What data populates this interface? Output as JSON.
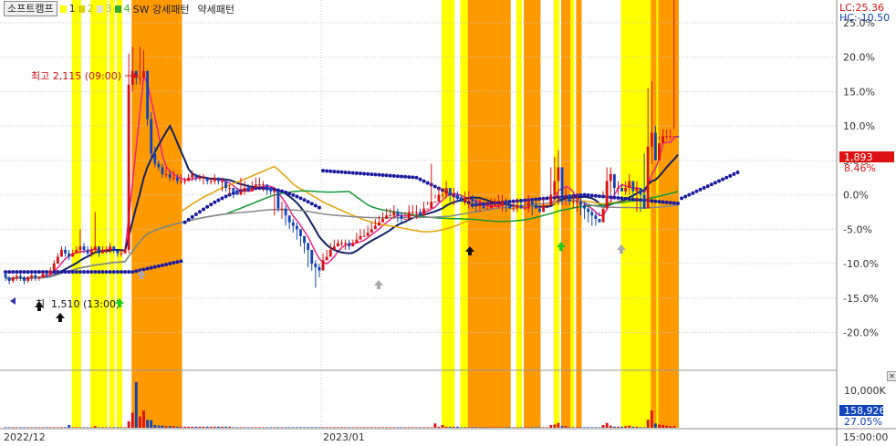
{
  "legend": {
    "title": "소프트캠프",
    "items": [
      {
        "label": "1",
        "color": "#ffff00"
      },
      {
        "label": "2",
        "color": "#e0d000"
      },
      {
        "label": "3",
        "color": "#dddddd"
      },
      {
        "label": "4",
        "color": "#33aa33"
      }
    ],
    "strong_label": "SW 강세패턴",
    "weak_label": "약세패턴"
  },
  "annotations": {
    "high": "최고 2,115 (09:00)",
    "low_prefix": "최",
    "low": "1,510 (13:00)"
  },
  "right_panel": {
    "lc": "LC:25.36",
    "hc": "HC:-10.50",
    "price_badge": "1,893",
    "pct_badge": "8.46%",
    "volume_badge": "158,926",
    "volume_pct": "27.05%",
    "volume_tick": "10,000K"
  },
  "x_axis": {
    "labels": [
      "2022/12",
      "2023/01"
    ],
    "time": "15:00:00"
  },
  "colors": {
    "yellow_band": "#ffff00",
    "orange_band": "#ff9900",
    "up": "#dd1111",
    "down": "#1144bb",
    "ma_pink": "#ee2288",
    "ma_navy": "#112266",
    "ma_gold": "#e8a000",
    "ma_green": "#119933",
    "ma_gray": "#888888",
    "dots": "#1a1aa0"
  },
  "chart_data": {
    "type": "candlestick",
    "ylabel_unit": "%",
    "ylim": [
      -25.36,
      27.5
    ],
    "y_ticks": [
      25,
      20,
      15,
      10,
      5,
      0,
      -5,
      -10,
      -15,
      -20
    ],
    "y_tick_labels": [
      "25.0%",
      "20.0%",
      "15.0%",
      "10.0%",
      "5.0%",
      "0.0%",
      "-5.0%",
      "-10.0%",
      "-15.0%",
      "-20.0%"
    ],
    "series": [
      {
        "name": "candles",
        "x": [
          1,
          2,
          3,
          4,
          5,
          6,
          7,
          8,
          9,
          10,
          11,
          12,
          13,
          14,
          15,
          16,
          17,
          18,
          19,
          20,
          21,
          22,
          23,
          24,
          25,
          26,
          27,
          28,
          29,
          30,
          31,
          32,
          33,
          34,
          35,
          36,
          37,
          38,
          39,
          40,
          41,
          42,
          43,
          44,
          45,
          46,
          47,
          48,
          49,
          50,
          51,
          52,
          53,
          54,
          55,
          56,
          57,
          58,
          59,
          60,
          61,
          62,
          63,
          64,
          65,
          66,
          67,
          68,
          69,
          70,
          71,
          72,
          73,
          74,
          75,
          76,
          77,
          78,
          79,
          80,
          81,
          82,
          83,
          84,
          85,
          86,
          87,
          88,
          89,
          90,
          91,
          92,
          93,
          94,
          95,
          96,
          97,
          98,
          99,
          100,
          101,
          102,
          103,
          104,
          105,
          106,
          107,
          108,
          109,
          110,
          111,
          112,
          113,
          114,
          115,
          116,
          117,
          118,
          119,
          120,
          121,
          122,
          123,
          124,
          125,
          126,
          127,
          128,
          129,
          130,
          131,
          132,
          133,
          134,
          135,
          136,
          137,
          138,
          139,
          140,
          141,
          142,
          143,
          144,
          145,
          146,
          147,
          148,
          149,
          150,
          151,
          152,
          153,
          154,
          155,
          156,
          157,
          158,
          159,
          160,
          161,
          162,
          163,
          164,
          165,
          166,
          167,
          168,
          169,
          170,
          171,
          172,
          173,
          174,
          175,
          176,
          177,
          178,
          179,
          180,
          181,
          182,
          183,
          184
        ],
        "open": [
          -11.5,
          -12,
          -12.5,
          -12,
          -11.8,
          -12,
          -12.5,
          -12,
          -11.7,
          -12,
          -12,
          -11.5,
          -11.6,
          -11,
          -10,
          -9,
          -8,
          -8.5,
          -9,
          -8.5,
          -8,
          -7.5,
          -8,
          -8.5,
          -8,
          -7.5,
          -8.5,
          -8,
          -8,
          -7.5,
          -8,
          -8.5,
          -8.5,
          -8,
          16,
          18,
          17,
          17,
          18,
          11,
          6,
          4.5,
          4,
          3,
          3,
          2.5,
          2.5,
          2,
          2,
          2,
          2.5,
          3,
          2.5,
          2.5,
          2.5,
          2,
          2,
          2.5,
          2,
          2,
          1,
          1,
          0.5,
          0,
          0.5,
          1,
          0.5,
          1,
          1.5,
          1.5,
          1.5,
          1,
          0.5,
          0.5,
          -2,
          -2,
          -3,
          -4,
          -4.5,
          -5,
          -6,
          -7,
          -8,
          -10,
          -10.5,
          -11,
          -9.5,
          -9,
          -8,
          -7.5,
          -7,
          -7,
          -7,
          -7.5,
          -7,
          -6.5,
          -6,
          -6,
          -5.5,
          -5,
          -4.5,
          -4,
          -3.5,
          -3,
          -3,
          -2.5,
          -3,
          -3.5,
          -3.5,
          -2.5,
          -2.5,
          -2.5,
          -3,
          -2,
          -2,
          -1,
          -1,
          0,
          0,
          1,
          0,
          0,
          -0.5,
          -1,
          -0.5,
          -0.5,
          -1,
          -1.5,
          -1.5,
          -2,
          -2,
          -1.5,
          -1.5,
          -1.5,
          -1,
          -1.5,
          -2,
          -2,
          -1.5,
          -2,
          -2,
          -1,
          -1.5,
          -2,
          -2.5,
          -1.5,
          -1.5,
          0,
          2,
          4,
          0,
          0,
          -1,
          -1,
          -1,
          -1.5,
          -2,
          -2.5,
          -3,
          -3.5,
          -4,
          -2,
          2,
          3,
          1,
          1,
          0.5,
          1,
          2,
          0.5,
          1,
          0,
          -2,
          7,
          9,
          5,
          7.5,
          8.5,
          8.5,
          8.5,
          8.5
        ],
        "close": [
          -12,
          -12.5,
          -12,
          -11.8,
          -12,
          -12.5,
          -12,
          -11.7,
          -12,
          -12,
          -11.5,
          -11.6,
          -11,
          -10,
          -9,
          -8,
          -8.5,
          -9,
          -8.5,
          -8,
          -7.5,
          -8,
          -8.5,
          -8,
          -7.5,
          -8.5,
          -8,
          -8,
          -7.5,
          -8,
          -8.5,
          -8.5,
          -8,
          16,
          18,
          17,
          17,
          18,
          11,
          6,
          4.5,
          4,
          3,
          3,
          2.5,
          2.5,
          2,
          2,
          2,
          2.5,
          3,
          2.5,
          2.5,
          2.5,
          2,
          2,
          2.5,
          2,
          2,
          1,
          1,
          0.5,
          0,
          0.5,
          1,
          0.5,
          1,
          1.5,
          1.5,
          1.5,
          1,
          0.5,
          0.5,
          -2,
          -2,
          -3,
          -4,
          -4.5,
          -5,
          -6,
          -7,
          -8,
          -10,
          -10.5,
          -11,
          -9.5,
          -9,
          -8,
          -7.5,
          -7,
          -7,
          -7,
          -7.5,
          -7,
          -6.5,
          -6,
          -6,
          -5.5,
          -5,
          -4.5,
          -4,
          -3.5,
          -3,
          -3,
          -2.5,
          -3,
          -3.5,
          -3.5,
          -2.5,
          -2.5,
          -2.5,
          -3,
          -2,
          -2,
          -1,
          -1,
          0,
          0,
          1,
          0,
          0,
          -0.5,
          -1,
          -0.5,
          -0.5,
          -1,
          -1.5,
          -1.5,
          -2,
          -2,
          -1.5,
          -1.5,
          -1.5,
          -1,
          -1.5,
          -2,
          -2,
          -1.5,
          -2,
          -2,
          -1,
          -1.5,
          -2,
          -2.5,
          -1.5,
          -1.5,
          0,
          2,
          4,
          0,
          0,
          -1,
          -1,
          -1,
          -1.5,
          -2,
          -2.5,
          -3,
          -3.5,
          -4,
          -2,
          2,
          3,
          1,
          1,
          0.5,
          1,
          2,
          0.5,
          1,
          0,
          -2,
          7,
          9,
          5,
          7.5,
          8.5,
          8.5,
          8.5,
          8.5,
          8.46
        ],
        "high": [
          -11.2,
          -11.8,
          -11.8,
          -11.5,
          -11.5,
          -11.8,
          -11.8,
          -11.5,
          -11.5,
          -11.8,
          -11.2,
          -11.2,
          -10.5,
          -9.5,
          -8.5,
          -7.5,
          -7.5,
          -8,
          -8,
          -7.5,
          -5,
          -7,
          -7.5,
          -7.5,
          -2.5,
          -7.5,
          -7.5,
          -7.5,
          -7,
          -7.5,
          -8,
          -8,
          -7.5,
          20.5,
          21.5,
          18,
          21.5,
          21,
          18,
          12,
          7,
          5,
          4.5,
          4,
          3.5,
          3.5,
          3,
          3,
          2.5,
          3,
          3.5,
          3,
          3,
          3,
          2.5,
          2.5,
          3,
          2.5,
          2.5,
          2,
          1.5,
          1,
          1,
          2.5,
          2,
          1.5,
          2,
          2.5,
          2.5,
          2,
          1.5,
          1,
          1,
          0,
          -1,
          -1.5,
          -3,
          -3.5,
          -4,
          -5,
          -6,
          -7,
          -8,
          -9.5,
          -10,
          -8.5,
          -8,
          -7,
          -6.5,
          -6.5,
          -6.5,
          -6.5,
          -6.5,
          -6.5,
          -5.5,
          -5,
          -5,
          -4.5,
          -4,
          -3.5,
          -3,
          -2.5,
          -2,
          -2,
          -1.5,
          -2,
          -2.5,
          -2.5,
          -1.5,
          -1.5,
          -1.5,
          -2,
          -1,
          -1,
          4.5,
          0,
          1,
          1,
          2,
          1,
          1,
          0.5,
          0,
          0.5,
          0.5,
          0,
          -0.5,
          -0.5,
          -1,
          -1,
          -0.5,
          -0.5,
          0,
          0,
          -0.5,
          -1,
          -1,
          -0.5,
          -1,
          -1,
          0,
          -0.5,
          -1,
          -1.5,
          -0.5,
          -0.5,
          4,
          5.5,
          6.5,
          1,
          1,
          0,
          0,
          0,
          -0.5,
          -1,
          -1.5,
          -2,
          -2.5,
          -3,
          0,
          4,
          4,
          2,
          2,
          1.5,
          2,
          3,
          1.5,
          2,
          1,
          0,
          15.5,
          16.5,
          10,
          8.5,
          9.5,
          9.5,
          9.5,
          9.5
        ],
        "low": [
          -12.5,
          -13,
          -12.8,
          -12.5,
          -12.5,
          -13,
          -12.8,
          -12.5,
          -12.5,
          -12.5,
          -12,
          -12,
          -11.5,
          -10.5,
          -9.5,
          -9,
          -9,
          -9.5,
          -9,
          -8.5,
          -8.5,
          -8.5,
          -9,
          -9,
          -8.5,
          -9,
          -8.5,
          -8.5,
          -8.5,
          -8.5,
          -9,
          -9,
          -8.5,
          -8.5,
          15,
          16,
          16,
          17,
          10,
          5,
          4,
          3.5,
          2.5,
          2.5,
          2,
          2,
          1.5,
          1.5,
          1.5,
          2,
          2,
          2,
          2,
          1.5,
          1.5,
          1.5,
          1.5,
          1.5,
          0.5,
          0.5,
          0,
          -0.5,
          0,
          0,
          0,
          0.5,
          1,
          1,
          1,
          0.5,
          0,
          0,
          -3,
          -2.5,
          -3.5,
          -4.5,
          -5,
          -5.5,
          -6.5,
          -7.5,
          -8.5,
          -10.5,
          -11,
          -13.5,
          -12,
          -10,
          -9,
          -8,
          -7.5,
          -7.5,
          -7.5,
          -8,
          -8,
          -7.5,
          -7,
          -6.5,
          -6,
          -5.5,
          -5,
          -4.5,
          -4,
          -3.5,
          -3.5,
          -3,
          -3.5,
          -4,
          -4,
          -3,
          -3,
          -3,
          -3.5,
          -2.5,
          -2.5,
          -1.5,
          -1.5,
          -0.5,
          -0.5,
          -0.5,
          -0.5,
          -1,
          -1.5,
          -1,
          -1,
          -1.5,
          -2,
          -2,
          -2.5,
          -2.5,
          -2,
          -2,
          -2,
          -1.5,
          -2,
          -2.5,
          -2.5,
          -2,
          -2.5,
          -2.5,
          -1.5,
          -2,
          -2.5,
          -3,
          -2,
          -2,
          -2,
          -0.5,
          -0.5,
          -0.5,
          -1.5,
          -1.5,
          -1.5,
          -1.5,
          -2,
          -2.5,
          -3,
          -3.5,
          -4,
          -4.5,
          -4.5,
          -2.5,
          0.5,
          0,
          0,
          0,
          0,
          1,
          0,
          0,
          -0.5,
          -2.5,
          -2.5,
          6,
          4.5,
          4.5,
          7,
          8,
          8,
          8,
          8
        ]
      },
      {
        "name": "volume",
        "values": [
          0.1,
          0.1,
          0.1,
          0.1,
          0.1,
          0.1,
          0.1,
          0.1,
          0.1,
          0.1,
          0.1,
          0.1,
          0.1,
          0.1,
          0.1,
          0.1,
          0.1,
          0.5,
          0.1,
          0.1,
          0.1,
          0.1,
          0.1,
          0.1,
          0.3,
          0.1,
          0.1,
          0.1,
          0.1,
          0.1,
          0.1,
          0.1,
          0.1,
          1.2,
          2.8,
          8.5,
          2.1,
          3.2,
          1.5,
          1.4,
          0.5,
          0.4,
          0.4,
          0.3,
          0.3,
          0.3,
          0.2,
          0.2,
          0.2,
          0.2,
          0.2,
          0.2,
          0.2,
          0.2,
          0.2,
          0.2,
          0.2,
          0.2,
          0.2,
          0.2,
          0.2,
          0.1,
          0.1,
          0.1,
          0.1,
          0.1,
          0.1,
          0.1,
          0.1,
          0.1,
          0.1,
          0.1,
          0.1,
          0.1,
          0.1,
          0.1,
          0.1,
          0.1,
          0.1,
          0.1,
          0.1,
          0.1,
          0.1,
          0.1,
          0.1,
          0.1,
          0.1,
          0.1,
          0.1,
          0.1,
          0.1,
          0.1,
          0.1,
          0.1,
          0.1,
          0.1,
          0.1,
          0.1,
          0.1,
          0.1,
          0.1,
          0.1,
          0.1,
          0.1,
          0.1,
          0.1,
          0.1,
          0.1,
          0.1,
          0.1,
          0.1,
          0.1,
          0.1,
          0.1,
          0.1,
          0.8,
          0.2,
          0.5,
          0.2,
          0.2,
          0.2,
          0.2,
          0.1,
          0.1,
          0.1,
          0.1,
          0.1,
          0.1,
          0.1,
          0.1,
          0.1,
          0.1,
          0.1,
          0.1,
          0.1,
          0.1,
          0.1,
          0.1,
          0.1,
          0.1,
          0.1,
          0.1,
          0.1,
          0.1,
          0.1,
          0.1,
          0.5,
          0.6,
          0.9,
          0.3,
          0.3,
          0.1,
          0.1,
          0.1,
          0.1,
          0.1,
          0.1,
          0.1,
          0.1,
          0.1,
          0.5,
          0.9,
          0.4,
          0.2,
          0.2,
          0.2,
          0.3,
          0.4,
          0.2,
          0.2,
          0.1,
          0.1,
          1.5,
          3.2,
          0.8,
          0.6,
          0.5,
          0.4,
          0.3,
          0.3
        ]
      }
    ],
    "yellow_bands": [
      [
        18,
        20
      ],
      [
        23,
        27
      ],
      [
        28,
        29
      ],
      [
        30,
        31
      ],
      [
        117,
        120
      ],
      [
        122,
        124
      ],
      [
        137,
        138
      ],
      [
        147,
        148
      ],
      [
        151,
        152
      ],
      [
        165,
        173
      ],
      [
        174,
        175
      ]
    ],
    "orange_bands": [
      [
        34,
        47
      ],
      [
        124,
        135
      ],
      [
        139,
        143
      ],
      [
        149,
        151
      ],
      [
        153,
        154
      ],
      [
        173,
        174
      ],
      [
        175,
        180
      ]
    ]
  }
}
